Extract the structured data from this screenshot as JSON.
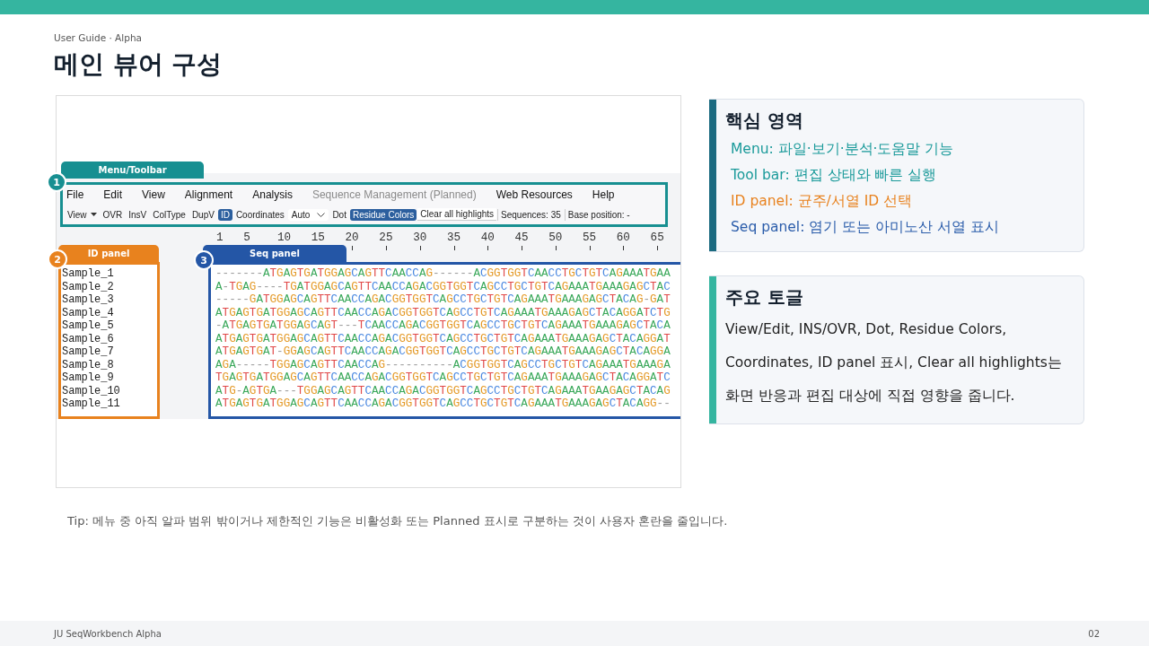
{
  "header": {
    "eyebrow": "User Guide · Alpha",
    "title": "메인 뷰어 구성"
  },
  "screenshot": {
    "callouts": [
      {
        "number": "1",
        "label": "Menu/Toolbar",
        "color": "#178f91"
      },
      {
        "number": "2",
        "label": "ID panel",
        "color": "#e8821e"
      },
      {
        "number": "3",
        "label": "Seq panel",
        "color": "#2456a6"
      }
    ],
    "menu": [
      {
        "label": "File",
        "disabled": false
      },
      {
        "label": "Edit",
        "disabled": false
      },
      {
        "label": "View",
        "disabled": false
      },
      {
        "label": "Alignment",
        "disabled": false
      },
      {
        "label": "Analysis",
        "disabled": false
      },
      {
        "label": "Sequence Management (Planned)",
        "disabled": true
      },
      {
        "label": "Web Resources",
        "disabled": false
      },
      {
        "label": "Help",
        "disabled": false
      }
    ],
    "toolbar": [
      {
        "kind": "dropdown",
        "label": "View"
      },
      {
        "kind": "toggle",
        "label": "OVR",
        "selected": false
      },
      {
        "kind": "toggle",
        "label": "InsV",
        "selected": false
      },
      {
        "kind": "toggle",
        "label": "ColType",
        "selected": false
      },
      {
        "kind": "toggle",
        "label": "DupV",
        "selected": false
      },
      {
        "kind": "toggle",
        "label": "ID",
        "selected": true
      },
      {
        "kind": "label",
        "label": "Coordinates"
      },
      {
        "kind": "select",
        "label": "Auto"
      },
      {
        "kind": "toggle",
        "label": "Dot",
        "selected": false
      },
      {
        "kind": "toggle",
        "label": "Residue Colors",
        "selected": true
      },
      {
        "kind": "button",
        "label": "Clear all highlights"
      },
      {
        "kind": "status",
        "label": "Sequences: 35"
      },
      {
        "kind": "status",
        "label": "Base position: -"
      }
    ],
    "ruler": [
      "1",
      "5",
      "10",
      "15",
      "20",
      "25",
      "30",
      "35",
      "40",
      "45",
      "50",
      "55",
      "60",
      "65"
    ],
    "ids": [
      "Sample_1",
      "Sample_2",
      "Sample_3",
      "Sample_4",
      "Sample_5",
      "Sample_6",
      "Sample_7",
      "Sample_8",
      "Sample_9",
      "Sample_10",
      "Sample_11"
    ],
    "sequences": [
      "-------ATGAGTGATGGAGCAGTTCAACCAG------ACGGTGGTCAACCTGCTGTCAGAAATGAA",
      "A-TGAG----TGATGGAGCAGTTCAACCAGACGGTGGTCAGCCTGCTGTCAGAAATGAAAGAGCTAC",
      "-----GATGGAGCAGTTCAACCAGACGGTGGTCAGCCTGCTGTCAGAAATGAAAGAGCTACAG-GAT",
      "ATGAGTGATGGAGCAGTTCAACCAGACGGTGGTCAGCCTGTCAGAAATGAAAGAGCTACAGGATCTG",
      "-ATGAGTGATGGAGCAGT---TCAACCAGACGGTGGTCAGCCTGCTGTCAGAAATGAAAGAGCTACA",
      "ATGAGTGATGGAGCAGTTCAACCAGACGGTGGTCAGCCTGCTGTCAGAAATGAAAGAGCTACAGGAT",
      "ATGAGTGAT-GGAGCAGTTCAACCAGACGGTGGTCAGCCTGCTGTCAGAAATGAAAGAGCTACAGGA",
      "AGA-----TGGAGCAGTTCAACCAG----------ACGGTGGTCAGCCTGCTGTCAGAAATGAAAGA",
      "TGAGTGATGGAGCAGTTCAACCAGACGGTGGTCAGCCTGCTGTCAGAAATGAAAGAGCTACAGGATC",
      "ATG-AGTGA---TGGAGCAGTTCAACCAGACGGTGGTCAGCCTGCTGTCAGAAATGAAGAGCTACAG",
      "ATGAGTGATGGAGCAGTTCAACCAGACGGTGGTCAGCCTGCTGTCAGAAATGAAAGAGCTACAGG--"
    ]
  },
  "cards": [
    {
      "kind": "list",
      "title": "핵심 영역",
      "color": "#1b6a80",
      "items": [
        {
          "text": "Menu: 파일·보기·분석·도움말 기능",
          "color": "#1a9a9a"
        },
        {
          "text": "Tool bar: 편집 상태와 빠른 실행",
          "color": "#1a9a9a"
        },
        {
          "text": "ID panel: 균주/서열 ID 선택",
          "color": "#e8821e"
        },
        {
          "text": "Seq panel: 염기 또는 아미노산 서열 표시",
          "color": "#2a5caa"
        }
      ]
    },
    {
      "kind": "text",
      "title": "주요 토글",
      "color": "#35b5a0",
      "text": "View/Edit, INS/OVR, Dot, Residue Colors, Coordinates, ID panel 표시, Clear all highlights는 화면 반응과 편집 대상에 직접 영향을 줍니다."
    }
  ],
  "tip": "Tip: 메뉴 중 아직 알파 범위 밖이거나 제한적인 기능은 비활성화 또는 Planned 표시로 구분하는 것이 사용자 혼란을 줄입니다.",
  "footer": {
    "product": "JU SeqWorkbench Alpha",
    "page": "02"
  }
}
